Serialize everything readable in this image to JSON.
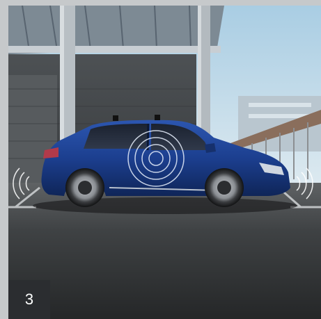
{
  "slide": {
    "number": "3"
  },
  "colors": {
    "frame": "#c6c9cb",
    "badge_bg": "#2b2d30",
    "car_body": "#1c3f8f",
    "sky": "#cfe3ee",
    "asphalt": "#3a3c3e"
  },
  "icons": {
    "left_sensor": "parking-sensor-waves-icon",
    "right_sensor": "parking-sensor-waves-icon",
    "center_sensor": "radar-rings-icon"
  }
}
